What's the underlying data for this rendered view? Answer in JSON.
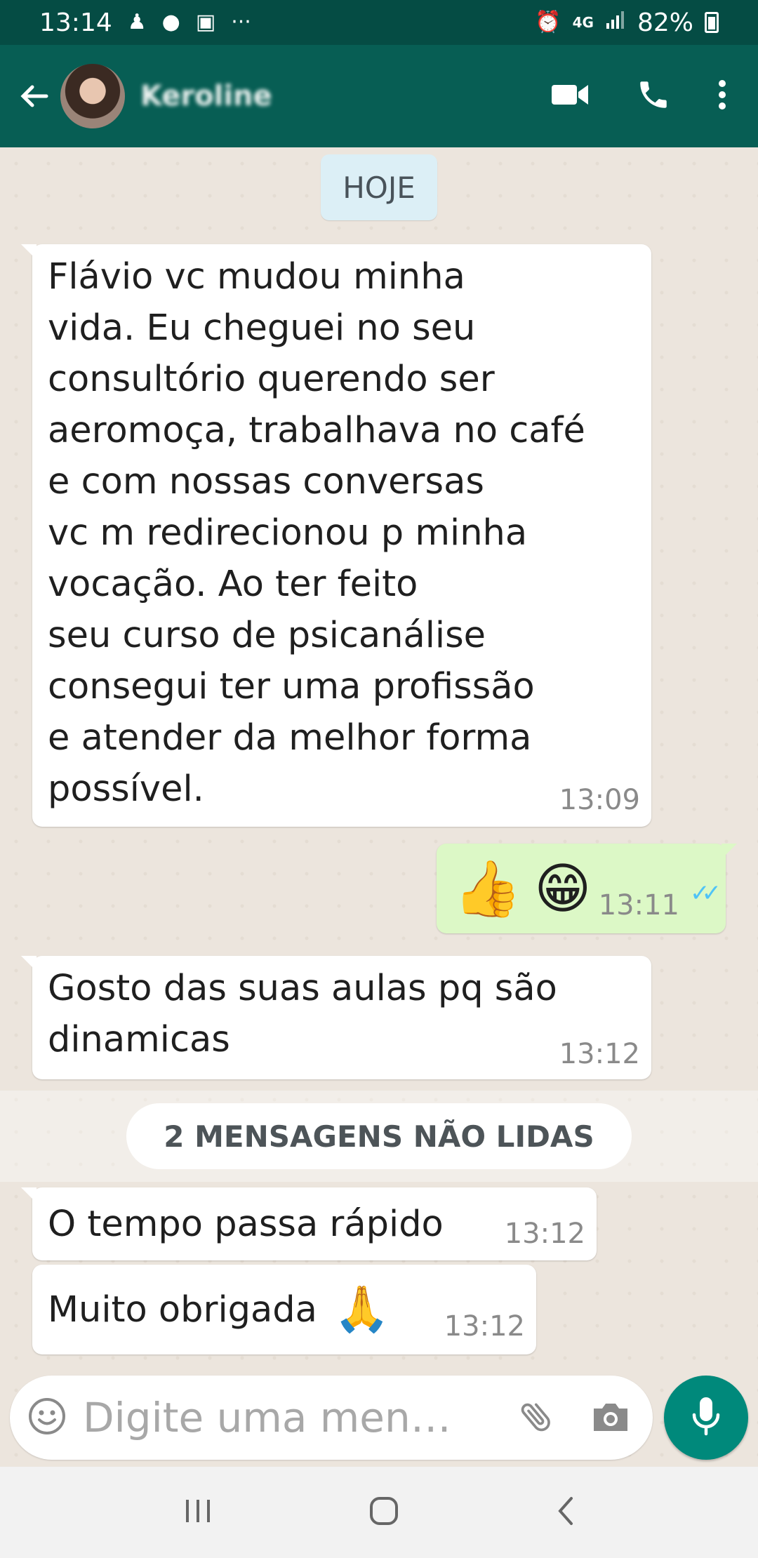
{
  "status_bar": {
    "time": "13:14",
    "network": "4G",
    "battery": "82%",
    "battery_level": 0.82,
    "icons": [
      "notification-icon",
      "notification-icon",
      "voicemail-icon",
      "more-icon",
      "alarm-icon",
      "network-icon",
      "signal-icon",
      "battery-icon"
    ]
  },
  "header": {
    "contact_name": "Keroline",
    "actions": [
      "video-call-icon",
      "voice-call-icon",
      "more-vert-icon"
    ]
  },
  "chat": {
    "date_label": "HOJE",
    "messages": [
      {
        "direction": "in",
        "text": "Flávio vc mudou minha\nvida. Eu cheguei no seu\nconsultório querendo ser\naeromoça, trabalhava no café\ne com nossas conversas\nvc m redirecionou p minha\nvocação. Ao ter feito\nseu curso de psicanálise\nconsegui ter uma profissão\ne atender da melhor forma\npossível.",
        "time": "13:09"
      },
      {
        "direction": "out",
        "emojis": [
          "👍",
          "😁"
        ],
        "time": "13:11",
        "status": "read"
      },
      {
        "direction": "in",
        "text": "Gosto das suas aulas pq são\ndinamicas",
        "time": "13:12"
      },
      {
        "direction": "in",
        "text": "O tempo passa rápido",
        "time": "13:12"
      },
      {
        "direction": "in",
        "text": "Muito obrigada",
        "emoji": "🙏",
        "time": "13:12"
      }
    ],
    "unread_label": "2 MENSAGENS NÃO LIDAS"
  },
  "composer": {
    "placeholder": "Digite uma men…",
    "icons": [
      "emoji-icon",
      "attach-icon",
      "camera-icon",
      "mic-icon"
    ]
  },
  "navigation": [
    "recents-icon",
    "home-icon",
    "back-icon"
  ],
  "colors": {
    "header": "#075e54",
    "status_bar": "#054c44",
    "chat_background": "#ece5dd",
    "incoming_bubble": "#ffffff",
    "outgoing_bubble": "#dcf8c6",
    "accent": "#00897b",
    "read_ticks": "#4fc3f7"
  }
}
